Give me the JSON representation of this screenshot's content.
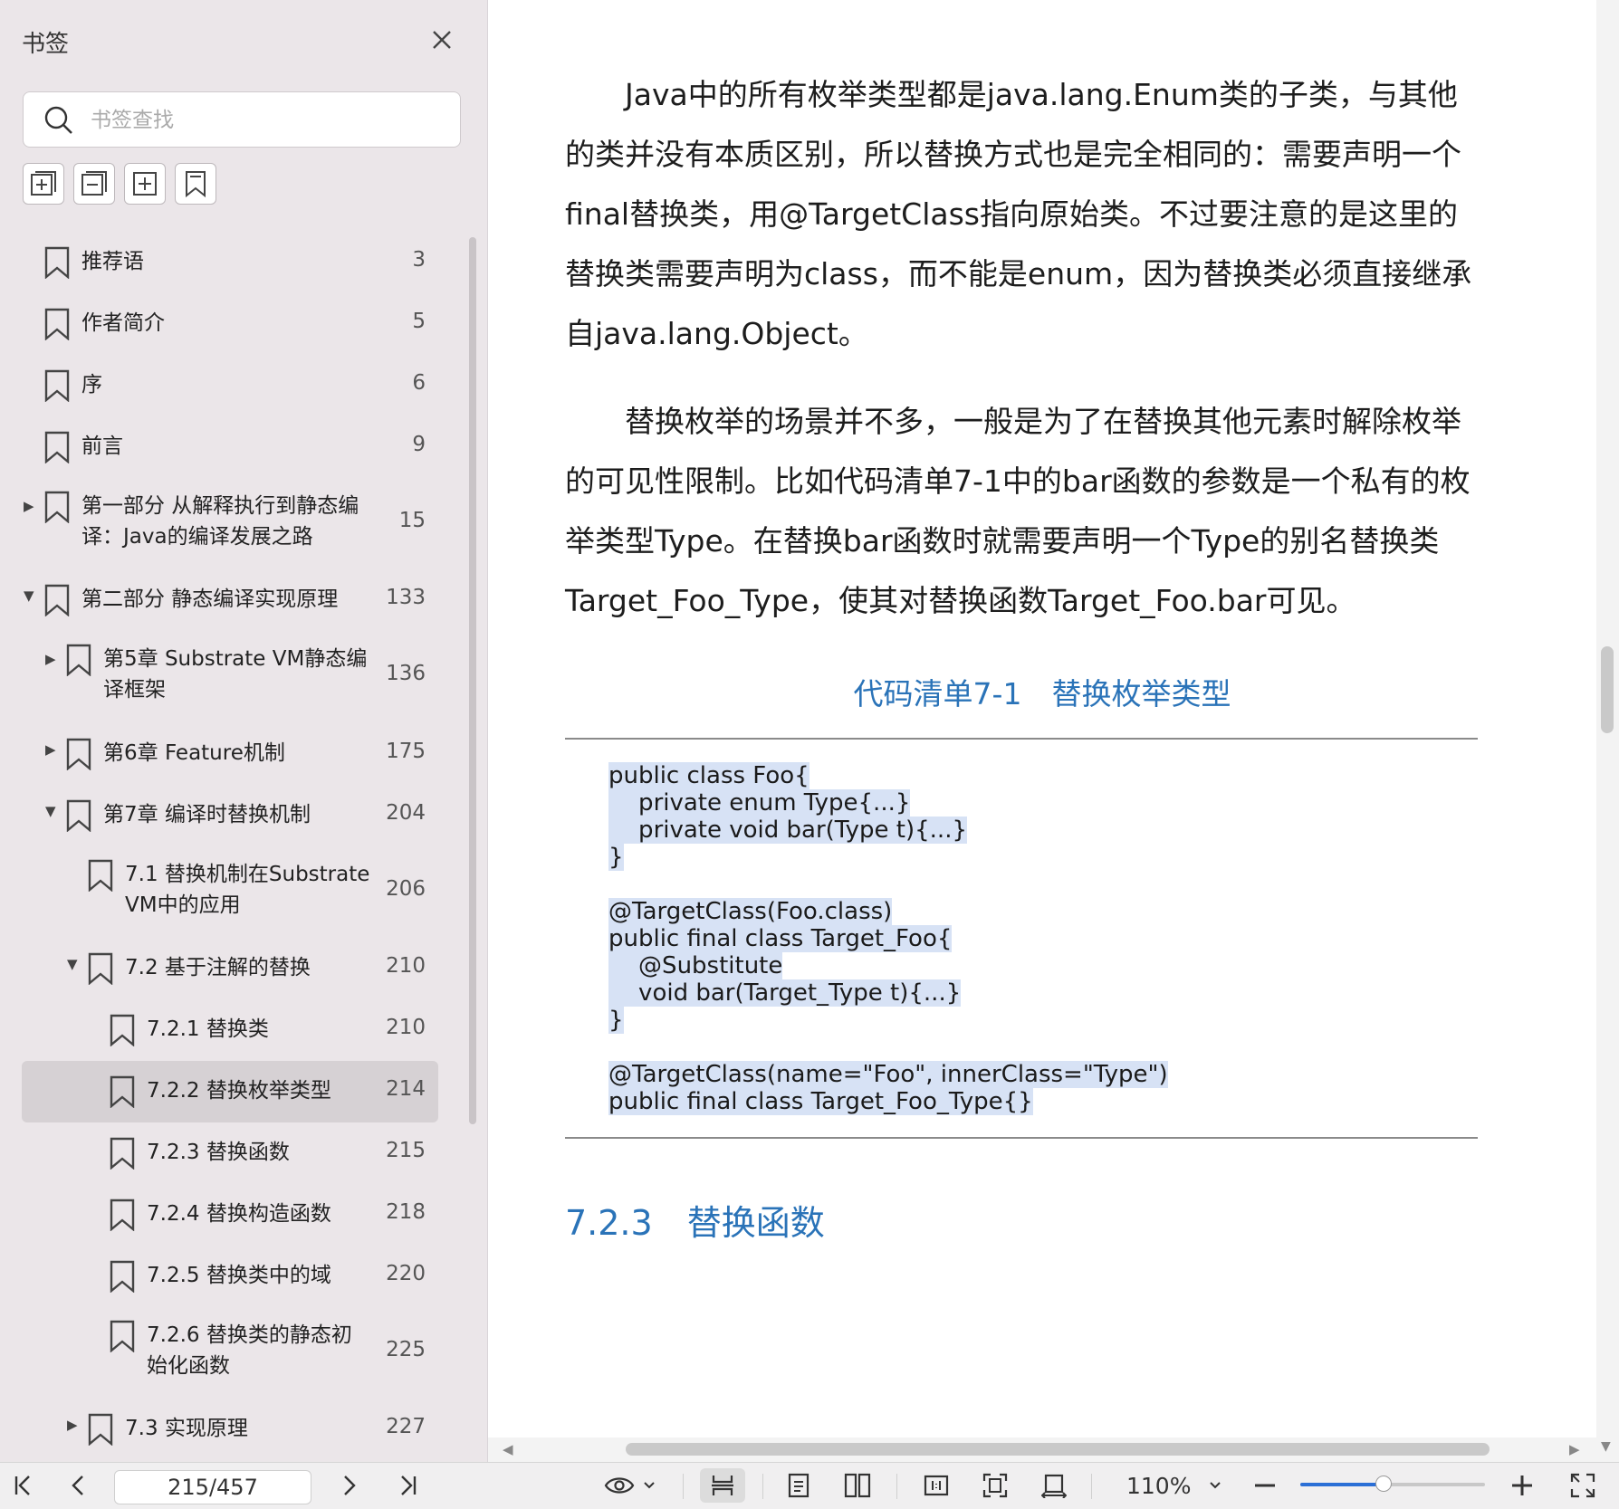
{
  "sidebar": {
    "title": "书签",
    "search_placeholder": "书签查找",
    "tools": [
      "add-bookmark-icon",
      "collapse-all-icon",
      "add-child-bookmark-icon",
      "bookmark-icon"
    ],
    "items": [
      {
        "label": "推荐语",
        "label2": "",
        "page": "3",
        "level": 0,
        "arrow": "",
        "active": false
      },
      {
        "label": "作者简介",
        "label2": "",
        "page": "5",
        "level": 0,
        "arrow": "",
        "active": false
      },
      {
        "label": "序",
        "label2": "",
        "page": "6",
        "level": 0,
        "arrow": "",
        "active": false
      },
      {
        "label": "前言",
        "label2": "",
        "page": "9",
        "level": 0,
        "arrow": "",
        "active": false
      },
      {
        "label": "第一部分 从解释执行到静态编",
        "label2": "译：Java的编译发展之路",
        "page": "15",
        "level": 0,
        "arrow": "▶",
        "active": false
      },
      {
        "label": "第二部分 静态编译实现原理",
        "label2": "",
        "page": "133",
        "level": 0,
        "arrow": "▼",
        "active": false
      },
      {
        "label": "第5章 Substrate VM静态编",
        "label2": "译框架",
        "page": "136",
        "level": 1,
        "arrow": "▶",
        "active": false
      },
      {
        "label": "第6章 Feature机制",
        "label2": "",
        "page": "175",
        "level": 1,
        "arrow": "▶",
        "active": false
      },
      {
        "label": "第7章 编译时替换机制",
        "label2": "",
        "page": "204",
        "level": 1,
        "arrow": "▼",
        "active": false
      },
      {
        "label": "7.1 替换机制在Substrate",
        "label2": "VM中的应用",
        "page": "206",
        "level": 2,
        "arrow": "",
        "active": false
      },
      {
        "label": "7.2 基于注解的替换",
        "label2": "",
        "page": "210",
        "level": 2,
        "arrow": "▼",
        "active": false
      },
      {
        "label": "7.2.1 替换类",
        "label2": "",
        "page": "210",
        "level": 3,
        "arrow": "",
        "active": false
      },
      {
        "label": "7.2.2 替换枚举类型",
        "label2": "",
        "page": "214",
        "level": 3,
        "arrow": "",
        "active": true
      },
      {
        "label": "7.2.3 替换函数",
        "label2": "",
        "page": "215",
        "level": 3,
        "arrow": "",
        "active": false
      },
      {
        "label": "7.2.4 替换构造函数",
        "label2": "",
        "page": "218",
        "level": 3,
        "arrow": "",
        "active": false
      },
      {
        "label": "7.2.5 替换类中的域",
        "label2": "",
        "page": "220",
        "level": 3,
        "arrow": "",
        "active": false
      },
      {
        "label": "7.2.6 替换类的静态初",
        "label2": "始化函数",
        "page": "225",
        "level": 3,
        "arrow": "",
        "active": false
      },
      {
        "label": "7.3 实现原理",
        "label2": "",
        "page": "227",
        "level": 2,
        "arrow": "▶",
        "active": false
      }
    ]
  },
  "document": {
    "para1": [
      "Java中的所有枚举类型都是java.lang.Enum类的子类，与其他",
      "的类并没有本质区别，所以替换方式也是完全相同的：需要声明一个",
      "final替换类，用@TargetClass指向原始类。不过要注意的是这里的",
      "替换类需要声明为class，而不能是enum，因为替换类必须直接继承",
      "自java.lang.Object。"
    ],
    "para2": [
      "替换枚举的场景并不多，一般是为了在替换其他元素时解除枚举",
      "的可见性限制。比如代码清单7-1中的bar函数的参数是一个私有的枚",
      "举类型Type。在替换bar函数时就需要声明一个Type的别名替换类",
      "Target_Foo_Type，使其对替换函数Target_Foo.bar可见。"
    ],
    "listing_caption": "代码清单7-1　替换枚举类型",
    "code_lines": [
      "public class Foo{",
      "    private enum Type{...}",
      "    private void bar(Type t){...}",
      "}",
      "",
      "@TargetClass(Foo.class)",
      "public final class Target_Foo{",
      "    @Substitute",
      "    void bar(Target_Type t){...}",
      "}",
      "",
      "@TargetClass(name=\"Foo\", innerClass=\"Type\")",
      "public final class Target_Foo_Type{}"
    ],
    "section_number": "7.2.3",
    "section_title": "替换函数"
  },
  "toolbar": {
    "page_indicator": "215/457",
    "zoom": "110%",
    "zoom_fraction": 0.45
  },
  "colors": {
    "sidebar_bg": "#ebe6e9",
    "accent_blue": "#2a73b8",
    "code_highlight": "#d7e2f5",
    "slider_fill": "#2b6fd6"
  }
}
